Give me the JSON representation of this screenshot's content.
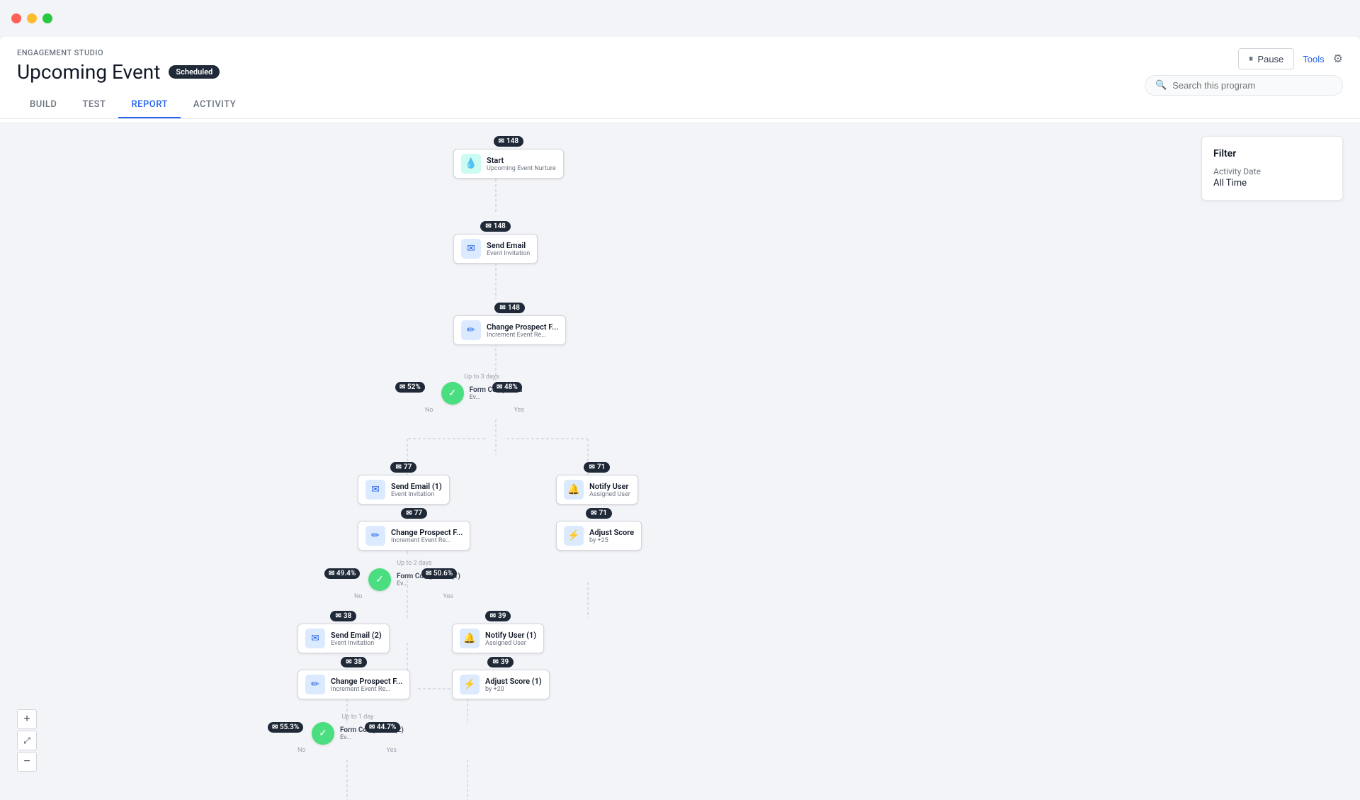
{
  "window": {
    "title": "Upcoming Event - Engagement Studio"
  },
  "chrome": {
    "traffic_red": "close",
    "traffic_yellow": "minimize",
    "traffic_green": "maximize"
  },
  "header": {
    "engagement_studio_label": "ENGAGEMENT STUDIO",
    "page_title": "Upcoming Event",
    "status_badge": "Scheduled",
    "pause_button": "Pause",
    "tools_button": "Tools"
  },
  "tabs": [
    {
      "id": "build",
      "label": "BUILD",
      "active": false
    },
    {
      "id": "test",
      "label": "TEST",
      "active": false
    },
    {
      "id": "report",
      "label": "REPORT",
      "active": true
    },
    {
      "id": "activity",
      "label": "ACTIVITY",
      "active": false
    }
  ],
  "search": {
    "placeholder": "Search this program"
  },
  "filter": {
    "title": "Filter",
    "date_label": "Activity Date",
    "date_value": "All Time"
  },
  "zoom": {
    "zoom_in": "+",
    "expand": "⤢",
    "zoom_out": "−"
  },
  "nodes": {
    "start": {
      "count": 148,
      "name": "Start",
      "sub": "Upcoming Event Nurture"
    },
    "send_email": {
      "count": 148,
      "name": "Send Email",
      "sub": "Event Invitation"
    },
    "change_prospect": {
      "count": 148,
      "name": "Change Prospect F...",
      "sub": "Increment Event Re..."
    },
    "form_completed_decision": {
      "name": "Form Completed",
      "sub": "Ev...",
      "label_up": "Up to 3 days",
      "pct_yes": "48%",
      "pct_no": "52%"
    },
    "send_email_1": {
      "count": 77,
      "name": "Send Email (1)",
      "sub": "Event Invitation"
    },
    "change_prospect_1": {
      "count": 77,
      "name": "Change Prospect F...",
      "sub": "Increment Event Re..."
    },
    "notify_user": {
      "count": 71,
      "name": "Notify User",
      "sub": "Assigned User"
    },
    "adjust_score": {
      "count": 71,
      "name": "Adjust Score",
      "sub": "by +25"
    },
    "form_completed_1": {
      "name": "Form Completed (1)",
      "sub": "Ev...",
      "label_up": "Up to 2 days",
      "pct_yes": "50.6%",
      "pct_no": "49.4%"
    },
    "send_email_2": {
      "count": 38,
      "name": "Send Email (2)",
      "sub": "Event Invitation"
    },
    "change_prospect_2": {
      "count": 38,
      "name": "Change Prospect F...",
      "sub": "Increment Event Re..."
    },
    "notify_user_1": {
      "count": 39,
      "name": "Notify User (1)",
      "sub": "Assigned User"
    },
    "adjust_score_1": {
      "count": 39,
      "name": "Adjust Score (1)",
      "sub": "by +20"
    },
    "form_completed_2": {
      "name": "Form Completed (2)",
      "sub": "Ev...",
      "label_up": "Up to 1 day",
      "pct_yes": "44.7%",
      "pct_no": "55.3%"
    }
  }
}
